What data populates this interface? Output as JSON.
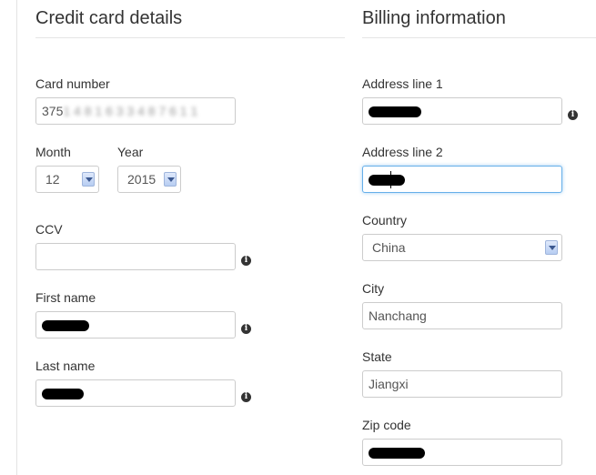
{
  "credit": {
    "heading": "Credit card details",
    "card_number": {
      "label": "Card number",
      "prefix": "375",
      "rest": "1 4 8 1 6 3 3 4 8 7 6 1 1"
    },
    "month": {
      "label": "Month",
      "value": "12"
    },
    "year": {
      "label": "Year",
      "value": "2015"
    },
    "ccv": {
      "label": "CCV",
      "value": ""
    },
    "first_name": {
      "label": "First name"
    },
    "last_name": {
      "label": "Last name"
    }
  },
  "billing": {
    "heading": "Billing information",
    "address1": {
      "label": "Address line 1"
    },
    "address2": {
      "label": "Address line 2"
    },
    "country": {
      "label": "Country",
      "value": "China"
    },
    "city": {
      "label": "City",
      "value": "Nanchang"
    },
    "state": {
      "label": "State",
      "value": "Jiangxi"
    },
    "zip": {
      "label": "Zip code"
    }
  },
  "icons": {
    "info": "i"
  }
}
